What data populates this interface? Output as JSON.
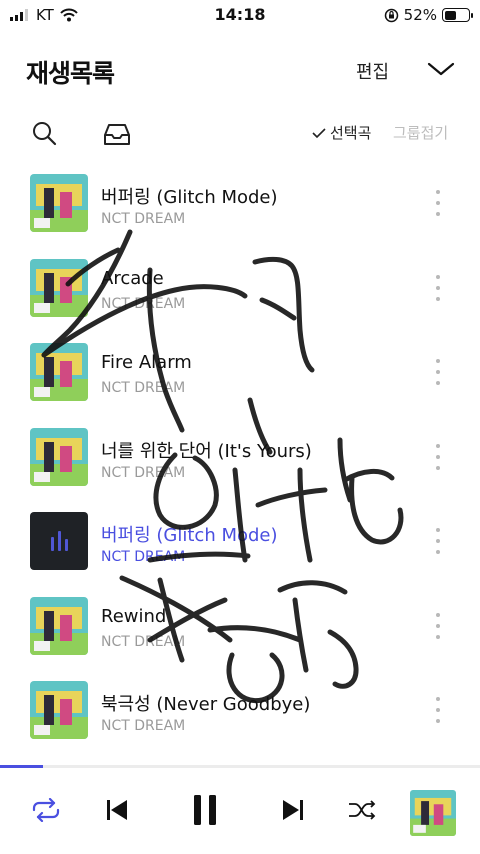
{
  "status_bar": {
    "carrier": "KT",
    "time": "14:18",
    "battery": "52%",
    "battery_level": 0.52
  },
  "header": {
    "title": "재생목록",
    "edit_label": "편집"
  },
  "toolbar": {
    "select_label": "선택곡",
    "group_label": "그룹접기"
  },
  "songs": [
    {
      "title": "버퍼링 (Glitch Mode)",
      "artist": "NCT DREAM",
      "playing": false
    },
    {
      "title": "Arcade",
      "artist": "NCT DREAM",
      "playing": false
    },
    {
      "title": "Fire Alarm",
      "artist": "NCT DREAM",
      "playing": false
    },
    {
      "title": "너를 위한 단어 (It's Yours)",
      "artist": "NCT DREAM",
      "playing": false
    },
    {
      "title": "버퍼링 (Glitch Mode)",
      "artist": "NCT DREAM",
      "playing": true
    },
    {
      "title": "Rewind",
      "artist": "NCT DREAM",
      "playing": false
    },
    {
      "title": "북극성 (Never Goodbye)",
      "artist": "NCT DREAM",
      "playing": false
    }
  ],
  "player": {
    "progress": 0.09,
    "icons": [
      "repeat-icon",
      "previous-icon",
      "pause-icon",
      "next-icon",
      "shuffle-icon"
    ]
  },
  "colors": {
    "accent": "#4a4fe0",
    "muted_text": "#9a9a9a",
    "dots": "#b8b8b8"
  }
}
